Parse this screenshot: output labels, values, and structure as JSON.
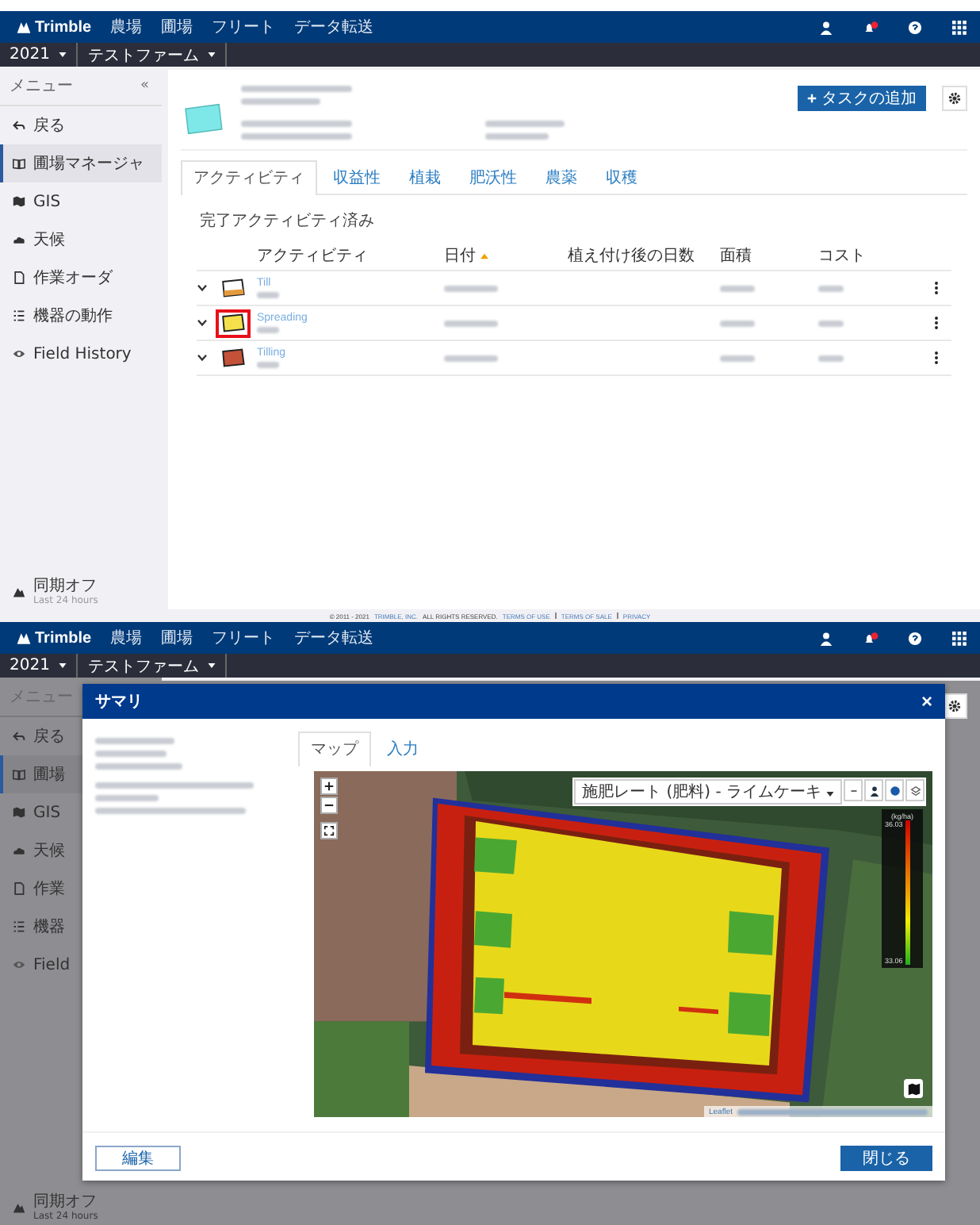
{
  "screens": [
    {
      "nav": {
        "logo": "Trimble",
        "links": [
          "農場",
          "圃場",
          "フリート",
          "データ転送"
        ]
      },
      "context": {
        "year": "2021",
        "farm": "テストファーム"
      },
      "sidebar": {
        "title": "メニュー",
        "collapse": "«",
        "items": [
          {
            "label": "戻る",
            "selected": false
          },
          {
            "label": "圃場マネージャ",
            "selected": true
          },
          {
            "label": "GIS",
            "selected": false
          },
          {
            "label": "天候",
            "selected": false
          },
          {
            "label": "作業オーダ",
            "selected": false
          },
          {
            "label": "機器の動作",
            "selected": false
          },
          {
            "label": "Field History",
            "selected": false
          }
        ],
        "sync": {
          "label": "同期オフ",
          "sub": "Last 24 hours"
        }
      },
      "main": {
        "add_button": "タスクの追加",
        "tabs": [
          {
            "label": "アクティビティ",
            "selected": true
          },
          {
            "label": "収益性",
            "selected": false
          },
          {
            "label": "植栽",
            "selected": false
          },
          {
            "label": "肥沃性",
            "selected": false
          },
          {
            "label": "農薬",
            "selected": false
          },
          {
            "label": "収穫",
            "selected": false
          }
        ],
        "section_title": "完了アクティビティ済み",
        "columns": [
          {
            "label": "アクティビティ",
            "sorted": false
          },
          {
            "label": "日付",
            "sorted": true
          },
          {
            "label": "植え付け後の日数",
            "sorted": false
          },
          {
            "label": "面積",
            "sorted": false
          },
          {
            "label": "コスト",
            "sorted": false
          }
        ],
        "rows": [
          {
            "name": "Till",
            "kind": "mixed",
            "highlighted": false
          },
          {
            "name": "Spreading",
            "kind": "yellow",
            "highlighted": true
          },
          {
            "name": "Tilling",
            "kind": "red",
            "highlighted": false
          }
        ]
      },
      "footer": {
        "copyright": "© 2011 - 2021",
        "company": "TRIMBLE, INC.",
        "rights": "ALL RIGHTS RESERVED.",
        "links": [
          "TERMS OF USE",
          "TERMS OF SALE",
          "PRIVACY"
        ]
      }
    },
    {
      "nav": {
        "logo": "Trimble",
        "links": [
          "農場",
          "圃場",
          "フリート",
          "データ転送"
        ]
      },
      "context": {
        "year": "2021",
        "farm": "テストファーム"
      },
      "sidebar": {
        "title": "メニュー",
        "items": [
          {
            "label": "戻る",
            "selected": false
          },
          {
            "label": "圃場",
            "selected": true
          },
          {
            "label": "GIS",
            "selected": false
          },
          {
            "label": "天候",
            "selected": false
          },
          {
            "label": "作業",
            "selected": false
          },
          {
            "label": "機器",
            "selected": false
          },
          {
            "label": "Field",
            "selected": false
          }
        ],
        "sync": {
          "label": "同期オフ",
          "sub": "Last 24 hours"
        }
      },
      "modal": {
        "title": "サマリ",
        "close": "×",
        "tabs": [
          {
            "label": "マップ",
            "selected": true
          },
          {
            "label": "入力",
            "selected": false
          }
        ],
        "layer_select": "施肥レート (肥料) - ライムケーキ",
        "legend": {
          "unit": "(kg/ha)",
          "max": "36.03",
          "min": "33.06"
        },
        "attribution": "Leaflet",
        "edit_button": "編集",
        "close_button": "閉じる"
      }
    }
  ]
}
